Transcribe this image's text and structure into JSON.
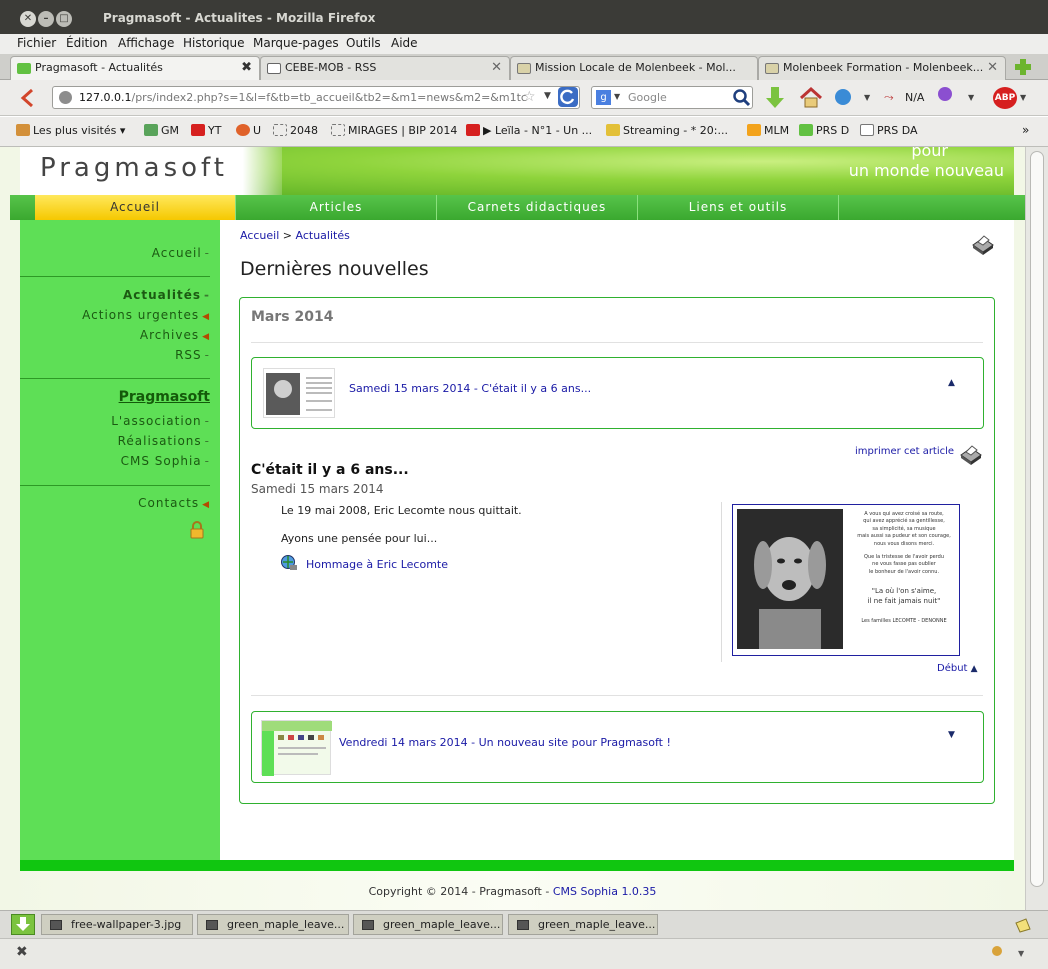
{
  "window": {
    "title": "Pragmasoft - Actualites - Mozilla Firefox"
  },
  "menubar": {
    "items": [
      "Fichier",
      "Édition",
      "Affichage",
      "Historique",
      "Marque-pages",
      "Outils",
      "Aide"
    ]
  },
  "tabs": [
    {
      "label": "Pragmasoft - Actualités"
    },
    {
      "label": "CEBE-MOB - RSS"
    },
    {
      "label": "Mission Locale de Molenbeek - Mol..."
    },
    {
      "label": "Molenbeek Formation - Molenbeek..."
    }
  ],
  "navbar": {
    "url_host": "127.0.0.1",
    "url_path": "/prs/index2.php?s=1&l=f&tb=tb_accueil&tb2=&m1=news&m2=&m1tc",
    "search_placeholder": "Google",
    "na_label": "N/A",
    "abp_label": "ABP"
  },
  "bookmarks": [
    "Les plus visités",
    "GM",
    "YT",
    "U",
    "2048",
    "MIRAGES | BIP 2014",
    "▶ Leïla - N°1 - Un ...",
    "Streaming - * 20:...",
    "MLM",
    "PRS D",
    "PRS DA"
  ],
  "site": {
    "name": "Pragmasoft",
    "slogan_1": "pour",
    "slogan_2": "un monde nouveau",
    "nav": [
      "Accueil",
      "Articles",
      "Carnets didactiques",
      "Liens et outils"
    ],
    "sidebar": {
      "group1": [
        "Accueil"
      ],
      "group2": [
        "Actualités",
        "Actions urgentes",
        "Archives",
        "RSS"
      ],
      "group3_title": "Pragmasoft",
      "group3": [
        "L'association",
        "Réalisations",
        "CMS Sophia"
      ],
      "group4": [
        "Contacts"
      ]
    },
    "breadcrumb": {
      "home": "Accueil",
      "sep": ">",
      "current": "Actualités"
    },
    "page_title": "Dernières nouvelles",
    "month_title": "Mars 2014",
    "news1_link": "Samedi 15 mars 2014 - C'était il y a 6 ans...",
    "print_article": "imprimer cet article",
    "article": {
      "title": "C'était il y a 6 ans...",
      "date": "Samedi 15 mars 2014",
      "p1": "Le 19 mai 2008, Eric Lecomte nous quittait.",
      "p2": "Ayons une pensée pour lui...",
      "link": "Hommage à Eric Lecomte",
      "card_text": [
        "A vous qui avez croisé sa route,",
        "qui avez apprécié sa gentillesse,",
        "sa simplicité, sa musique",
        "mais aussi sa pudeur et son courage,",
        "nous vous disons merci.",
        "Que la tristesse de l'avoir perdu",
        "ne vous fasse pas oublier",
        "le bonheur de l'avoir connu."
      ],
      "card_quote_1": "\"La où l'on s'aime,",
      "card_quote_2": "il ne fait jamais nuit\"",
      "card_sign": "Les familles LECOMTE - DENONNE"
    },
    "debut": "Début",
    "news2_link": "Vendredi 14 mars 2014 - Un nouveau site pour Pragmasoft !",
    "copyright": "Copyright © 2014 - Pragmasoft - ",
    "cms_link": "CMS Sophia 1.0.35"
  },
  "downloads": [
    "free-wallpaper-3.jpg",
    "green_maple_leave...",
    "green_maple_leave...",
    "green_maple_leave..."
  ],
  "colors": {
    "brand_green": "#3aa82f",
    "sidebar": "#5edf56",
    "link": "#1a1aa6",
    "active_tab": "#f5c800"
  }
}
